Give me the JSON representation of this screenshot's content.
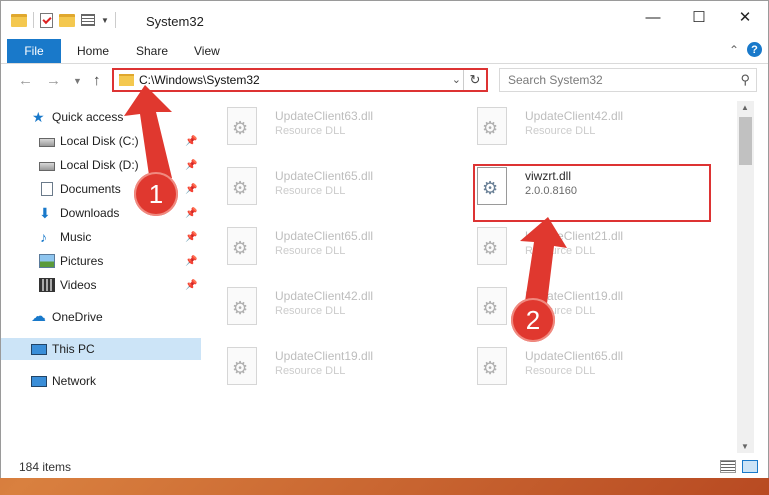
{
  "window": {
    "title": "System32",
    "controls": {
      "minimize": "—",
      "maximize": "☐",
      "close": "✕"
    }
  },
  "ribbon": {
    "file_tab": "File",
    "tabs": [
      "Home",
      "Share",
      "View"
    ]
  },
  "address": {
    "path": "C:\\Windows\\System32",
    "search_placeholder": "Search System32"
  },
  "sidebar": {
    "items": [
      {
        "label": "Quick access",
        "icon": "star-icon",
        "pinned": false
      },
      {
        "label": "Local Disk (C:)",
        "icon": "disk-icon",
        "pinned": true
      },
      {
        "label": "Local Disk (D:)",
        "icon": "disk-icon",
        "pinned": true
      },
      {
        "label": "Documents",
        "icon": "documents-icon",
        "pinned": true
      },
      {
        "label": "Downloads",
        "icon": "downloads-icon",
        "pinned": true
      },
      {
        "label": "Music",
        "icon": "music-icon",
        "pinned": true
      },
      {
        "label": "Pictures",
        "icon": "pictures-icon",
        "pinned": true
      },
      {
        "label": "Videos",
        "icon": "videos-icon",
        "pinned": true
      },
      {
        "label": "OneDrive",
        "icon": "onedrive-icon",
        "pinned": false
      },
      {
        "label": "This PC",
        "icon": "this-pc-icon",
        "pinned": false,
        "selected": true
      },
      {
        "label": "Network",
        "icon": "network-icon",
        "pinned": false
      }
    ]
  },
  "files": {
    "left_column": [
      {
        "name": "UpdateClient63.dll",
        "desc": "Resource DLL"
      },
      {
        "name": "UpdateClient65.dll",
        "desc": "Resource DLL"
      },
      {
        "name": "UpdateClient65.dll",
        "desc": "Resource DLL"
      },
      {
        "name": "UpdateClient42.dll",
        "desc": "Resource DLL"
      },
      {
        "name": "UpdateClient19.dll",
        "desc": "Resource DLL"
      }
    ],
    "right_column": [
      {
        "name": "UpdateClient42.dll",
        "desc": "Resource DLL"
      },
      {
        "name": "viwzrt.dll",
        "desc": "2.0.0.8160",
        "highlighted": true
      },
      {
        "name": "UpdateClient21.dll",
        "desc": "Resource DLL"
      },
      {
        "name": "UpdateClient19.dll",
        "desc": "Resource DLL"
      },
      {
        "name": "UpdateClient65.dll",
        "desc": "Resource DLL"
      }
    ]
  },
  "status": {
    "item_count": "184 items"
  },
  "annotations": {
    "step1": "1",
    "step2": "2",
    "color": "#e0382f"
  }
}
